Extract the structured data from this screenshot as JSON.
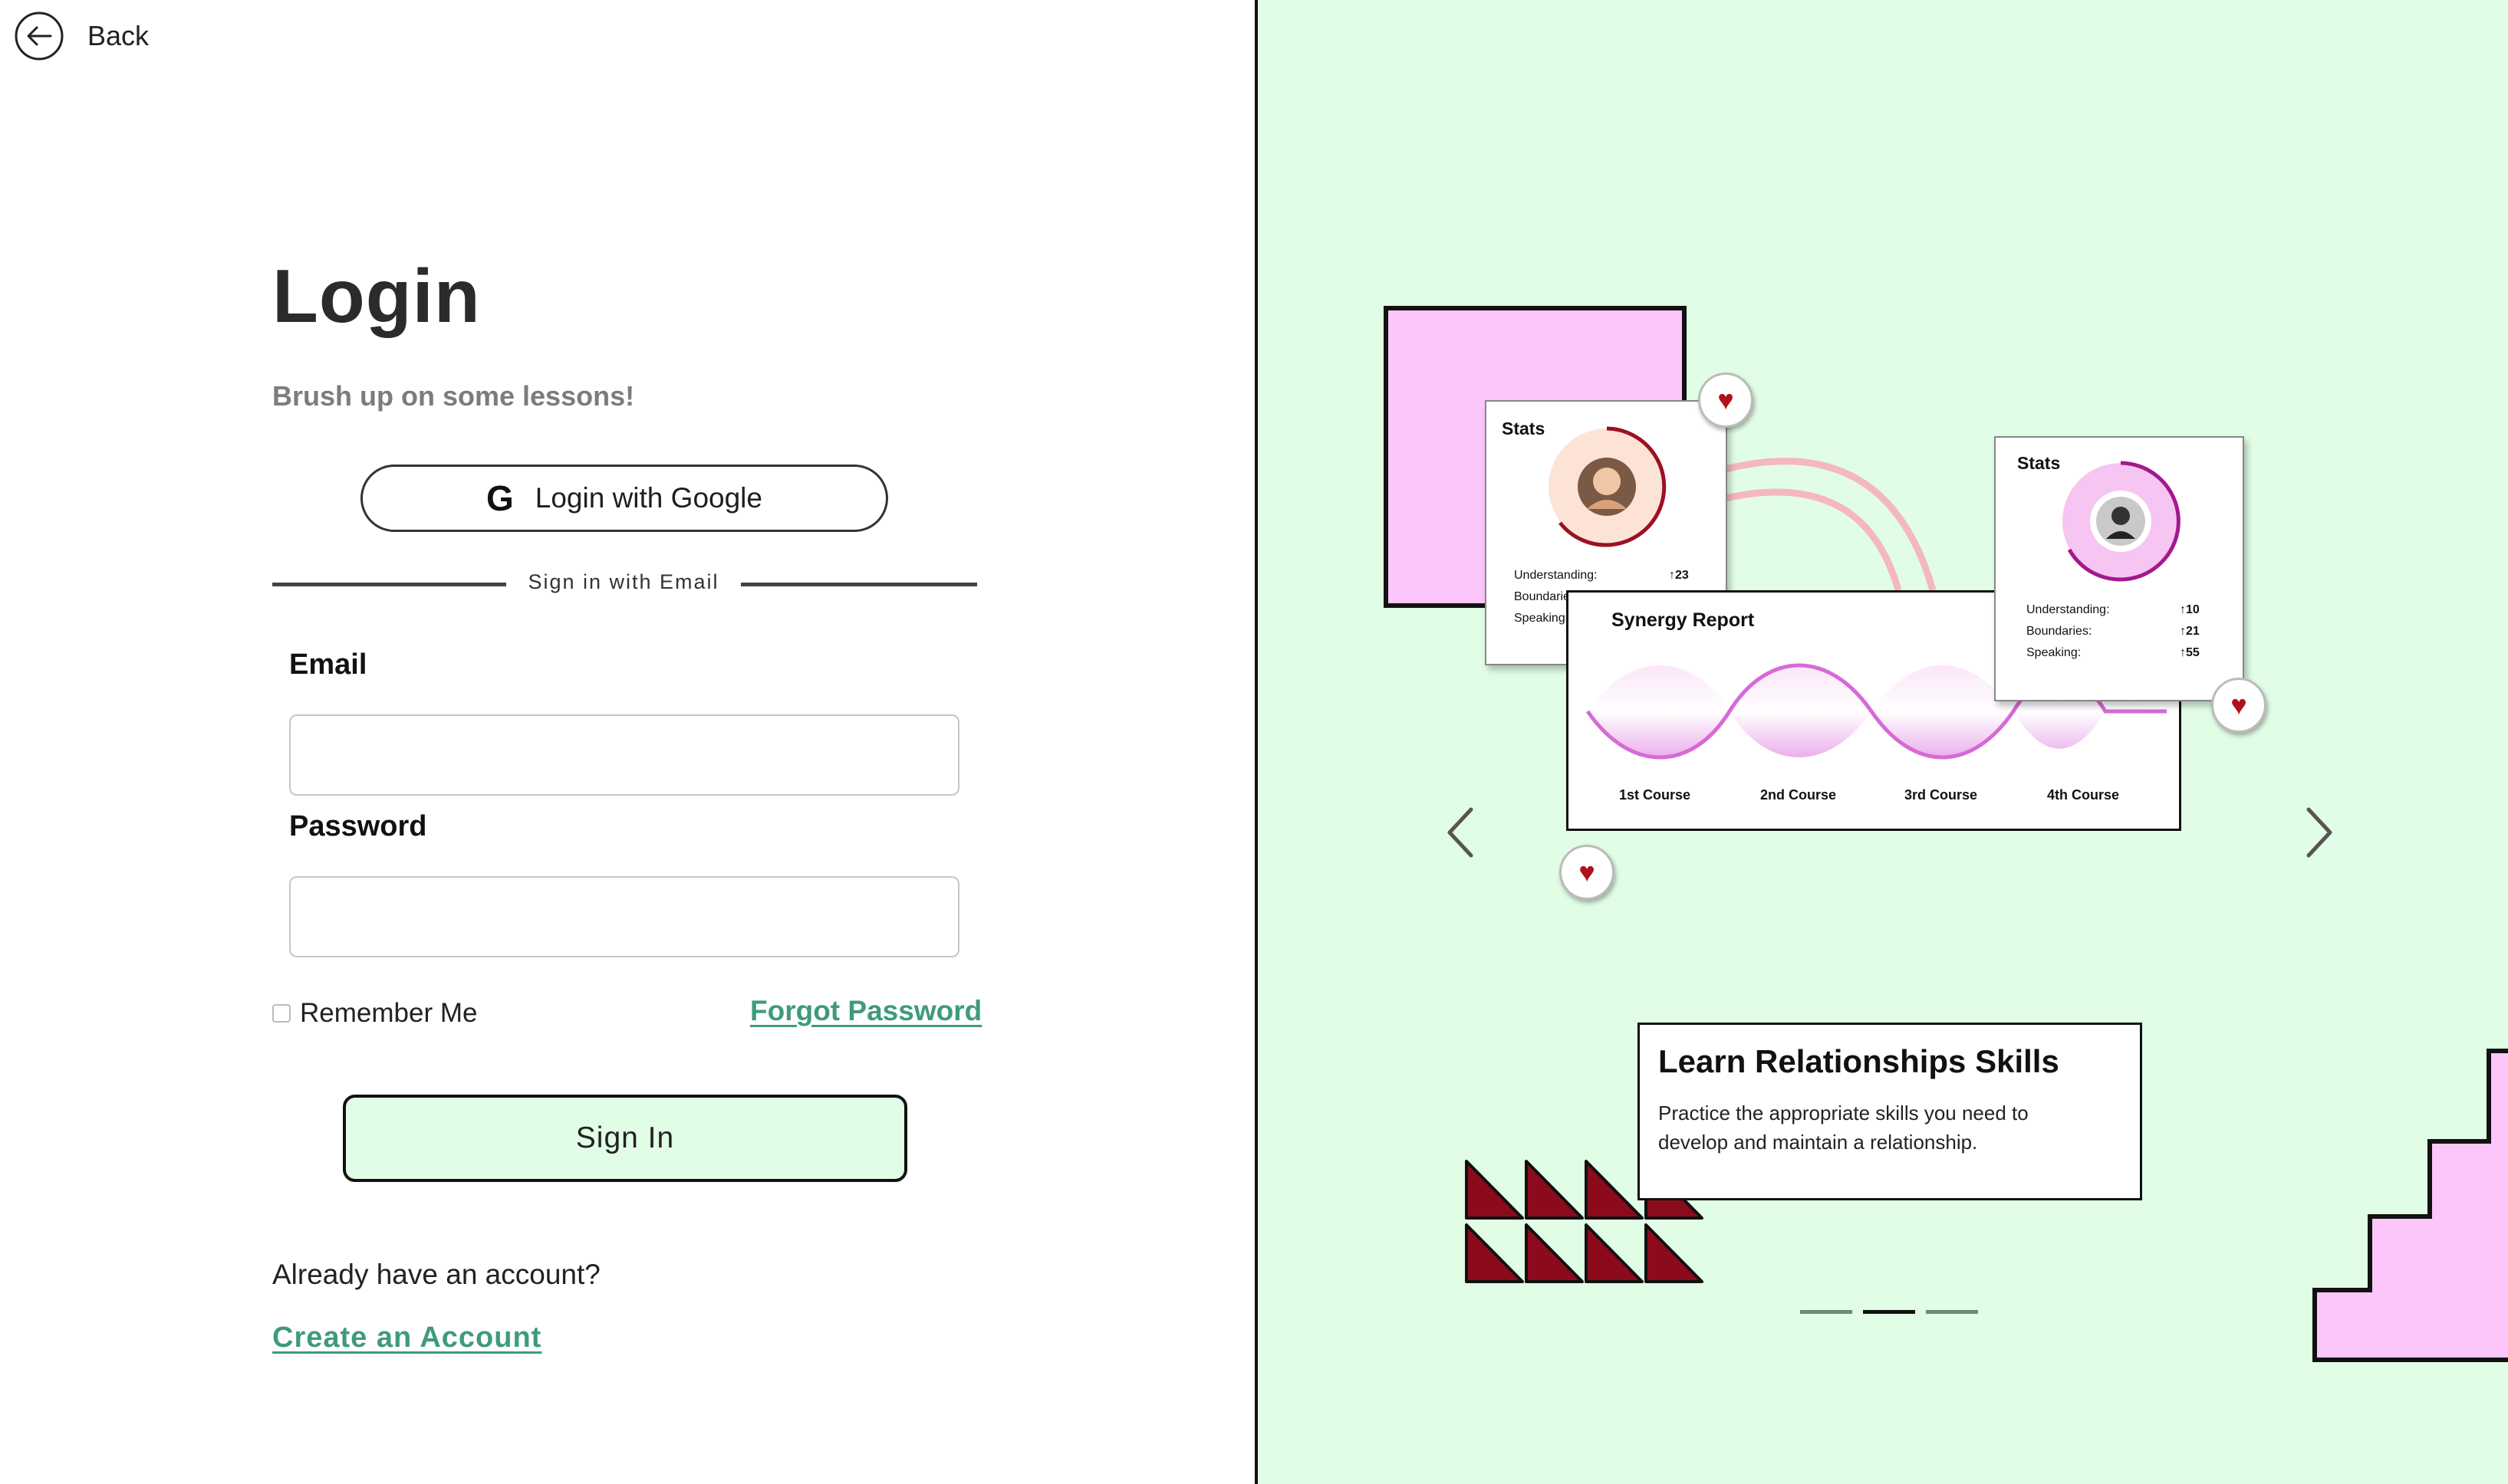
{
  "nav": {
    "back_label": "Back"
  },
  "login": {
    "title": "Login",
    "subtitle": "Brush up on some lessons!",
    "google_label": "Login with Google",
    "google_glyph": "G",
    "divider_text": "Sign in with Email",
    "email_label": "Email",
    "email_value": "",
    "password_label": "Password",
    "password_value": "",
    "remember_label": "Remember Me",
    "forgot_label": "Forgot Password",
    "signin_label": "Sign In",
    "already_text": "Already have an account?",
    "create_label": "Create an Account"
  },
  "showcase": {
    "stats_card_1": {
      "title": "Stats",
      "rows": [
        {
          "label": "Understanding:",
          "value": "↑23"
        },
        {
          "label": "Boundaries:",
          "value": ""
        },
        {
          "label": "Speaking:",
          "value": ""
        }
      ]
    },
    "stats_card_2": {
      "title": "Stats",
      "rows": [
        {
          "label": "Understanding:",
          "value": "↑10"
        },
        {
          "label": "Boundaries:",
          "value": "↑21"
        },
        {
          "label": "Speaking:",
          "value": "↑55"
        }
      ]
    },
    "synergy": {
      "title": "Synergy Report",
      "courses": [
        "1st Course",
        "2nd Course",
        "3rd Course",
        "4th Course"
      ]
    },
    "feature": {
      "title": "Learn Relationships Skills",
      "text": "Practice the appropriate skills you need to develop and maintain a relationship."
    },
    "carousel_active_index": 2,
    "carousel_count": 3,
    "heart_glyph": "♥"
  },
  "colors": {
    "accent_green": "#3f9a7e",
    "panel_bg": "#e1fde5",
    "pink": "#fdc6fb",
    "heart_red": "#b1111b",
    "triangle_red": "#8b0a1c"
  }
}
